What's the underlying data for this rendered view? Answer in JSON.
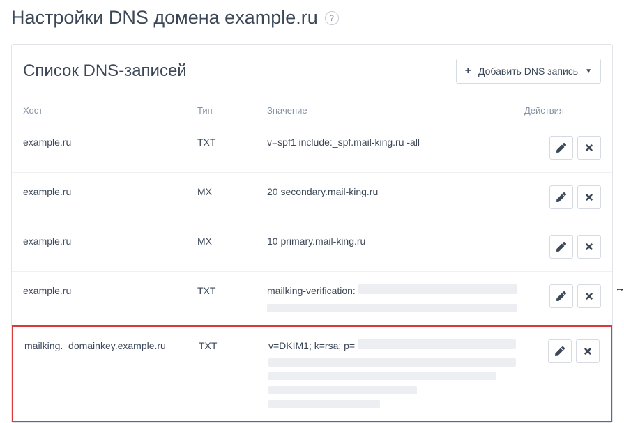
{
  "page": {
    "title": "Настройки DNS домена example.ru",
    "help_tooltip": "?"
  },
  "panel": {
    "heading": "Список DNS-записей",
    "add_button_label": "Добавить DNS запись"
  },
  "table": {
    "headers": {
      "host": "Хост",
      "type": "Тип",
      "value": "Значение",
      "actions": "Действия"
    },
    "rows": [
      {
        "host": "example.ru",
        "type": "TXT",
        "value": "v=spf1 include:_spf.mail-king.ru -all",
        "redacted": false
      },
      {
        "host": "example.ru",
        "type": "MX",
        "value": "20 secondary.mail-king.ru",
        "redacted": false
      },
      {
        "host": "example.ru",
        "type": "MX",
        "value": "10 primary.mail-king.ru",
        "redacted": false
      },
      {
        "host": "example.ru",
        "type": "TXT",
        "value": "mailking-verification: ",
        "redacted": true,
        "redacted_lines": 2
      },
      {
        "host": "mailking._domainkey.example.ru",
        "type": "TXT",
        "value": "v=DKIM1; k=rsa; p=",
        "redacted": true,
        "redacted_lines": 5,
        "highlighted": true
      }
    ]
  },
  "icons": {
    "edit": "pencil-icon",
    "delete": "close-icon",
    "add": "plus-icon",
    "dropdown": "caret-down-icon"
  }
}
